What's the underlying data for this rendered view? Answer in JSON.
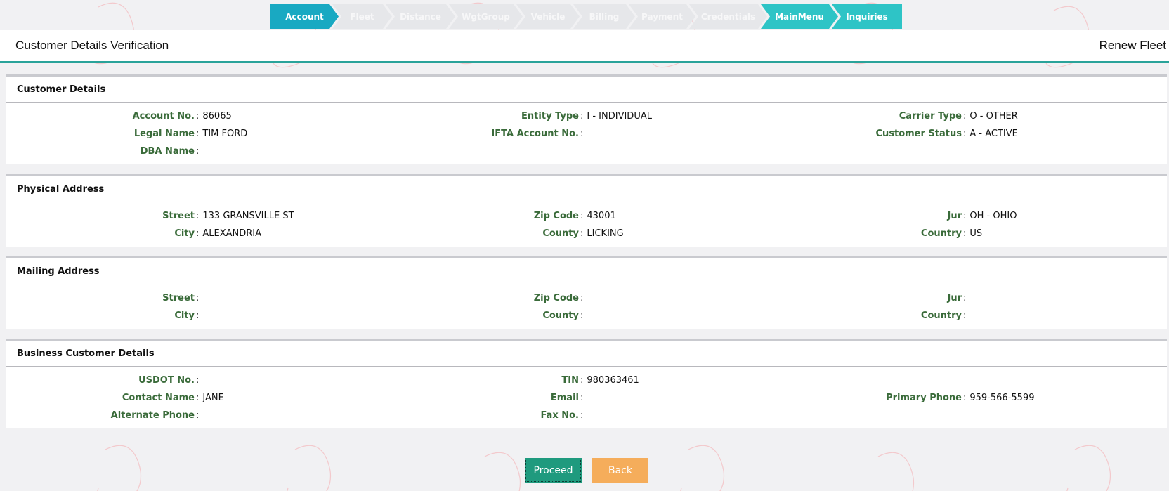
{
  "steps": [
    {
      "label": "Account",
      "state": "active"
    },
    {
      "label": "Fleet",
      "state": "inactive"
    },
    {
      "label": "Distance",
      "state": "inactive"
    },
    {
      "label": "WgtGroup",
      "state": "inactive"
    },
    {
      "label": "Vehicle",
      "state": "inactive"
    },
    {
      "label": "Billing",
      "state": "inactive"
    },
    {
      "label": "Payment",
      "state": "inactive"
    },
    {
      "label": "Credentials",
      "state": "inactive"
    },
    {
      "label": "MainMenu",
      "state": "link"
    },
    {
      "label": "Inquiries",
      "state": "link"
    }
  ],
  "header": {
    "title": "Customer Details Verification",
    "mode": "Renew Fleet"
  },
  "customer": {
    "heading": "Customer Details",
    "account_no": {
      "label": "Account No.",
      "value": "86065"
    },
    "entity_type": {
      "label": "Entity Type",
      "value": "I - INDIVIDUAL"
    },
    "carrier_type": {
      "label": "Carrier Type",
      "value": "O - OTHER"
    },
    "legal_name": {
      "label": "Legal Name",
      "value": "TIM FORD"
    },
    "ifta_account": {
      "label": "IFTA Account No.",
      "value": ""
    },
    "customer_status": {
      "label": "Customer Status",
      "value": "A - ACTIVE"
    },
    "dba_name": {
      "label": "DBA Name",
      "value": ""
    }
  },
  "physical": {
    "heading": "Physical Address",
    "street": {
      "label": "Street",
      "value": "133 GRANSVILLE ST"
    },
    "zip": {
      "label": "Zip Code",
      "value": "43001"
    },
    "jur": {
      "label": "Jur",
      "value": "OH - OHIO"
    },
    "city": {
      "label": "City",
      "value": "ALEXANDRIA"
    },
    "county": {
      "label": "County",
      "value": "LICKING"
    },
    "country": {
      "label": "Country",
      "value": "US"
    }
  },
  "mailing": {
    "heading": "Mailing Address",
    "street": {
      "label": "Street",
      "value": ""
    },
    "zip": {
      "label": "Zip Code",
      "value": ""
    },
    "jur": {
      "label": "Jur",
      "value": ""
    },
    "city": {
      "label": "City",
      "value": ""
    },
    "county": {
      "label": "County",
      "value": ""
    },
    "country": {
      "label": "Country",
      "value": ""
    }
  },
  "business": {
    "heading": "Business Customer Details",
    "usdot": {
      "label": "USDOT No.",
      "value": ""
    },
    "tin": {
      "label": "TIN",
      "value": "980363461"
    },
    "contact_name": {
      "label": "Contact Name",
      "value": "JANE"
    },
    "email": {
      "label": "Email",
      "value": ""
    },
    "primary_phone": {
      "label": "Primary Phone",
      "value": "959-566-5599"
    },
    "alternate_phone": {
      "label": "Alternate Phone",
      "value": ""
    },
    "fax": {
      "label": "Fax No.",
      "value": ""
    }
  },
  "actions": {
    "proceed": "Proceed",
    "back": "Back"
  },
  "colors": {
    "accent": "#19a9c2",
    "teal": "#2ec4c6",
    "label": "#3a6b3a",
    "proceed": "#1f9a7e",
    "back": "#f5ad5b",
    "divider": "#2aa39a"
  }
}
